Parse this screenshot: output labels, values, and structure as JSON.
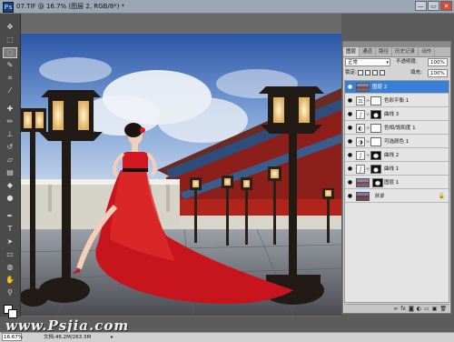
{
  "window": {
    "title": "07.TIF @ 16.7% (图层 2, RGB/8*) *",
    "buttons": {
      "minimize": "—",
      "restore": "▭",
      "close": "✕"
    }
  },
  "layers_panel": {
    "tabs": [
      "图层",
      "通道",
      "路径",
      "历史记录",
      "动作"
    ],
    "blend_mode": "正常",
    "opacity_label": "不透明度:",
    "opacity_value": "100%",
    "lock_label": "锁定:",
    "fill_label": "填充:",
    "fill_value": "100%",
    "layers": [
      {
        "name": "图层 2",
        "selected": true,
        "kind": "pixel"
      },
      {
        "name": "色彩平衡 1",
        "selected": false,
        "kind": "adjustment"
      },
      {
        "name": "曲线 3",
        "selected": false,
        "kind": "adjustment-dark-mask"
      },
      {
        "name": "色相/饱和度 1",
        "selected": false,
        "kind": "adjustment"
      },
      {
        "name": "可选颜色 1",
        "selected": false,
        "kind": "adjustment"
      },
      {
        "name": "曲线 2",
        "selected": false,
        "kind": "adjustment-dark-mask"
      },
      {
        "name": "曲线 1",
        "selected": false,
        "kind": "adjustment-dark-mask"
      },
      {
        "name": "图层 1",
        "selected": false,
        "kind": "pixel-mask"
      },
      {
        "name": "背景",
        "selected": false,
        "kind": "background"
      }
    ]
  },
  "status": {
    "zoom": "16.67%",
    "doc": "文档:46.2M/263.3M"
  },
  "watermark": "www.Psjia.com",
  "colors": {
    "selected_layer": "#3a7fd6",
    "dress_red": "#c8141c",
    "sky_blue": "#4f7fc0"
  }
}
